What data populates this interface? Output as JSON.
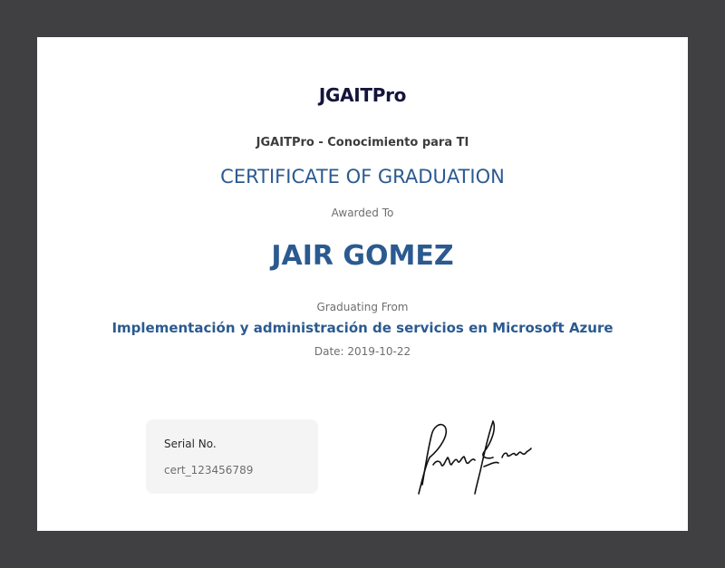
{
  "certificate": {
    "logo_text": "JGAITPro",
    "organization": "JGAITPro - Conocimiento para TI",
    "title": "CERTIFICATE OF GRADUATION",
    "awarded_to_label": "Awarded To",
    "recipient_name": "JAIR GOMEZ",
    "graduating_from_label": "Graduating From",
    "course_name": "Implementación y administración de servicios en Microsoft Azure",
    "date_text": "Date: 2019-10-22",
    "serial": {
      "label": "Serial No.",
      "value": "cert_123456789"
    }
  },
  "colors": {
    "backdrop": "#404042",
    "accent_blue": "#2b5a90",
    "logo_navy": "#14143c"
  }
}
